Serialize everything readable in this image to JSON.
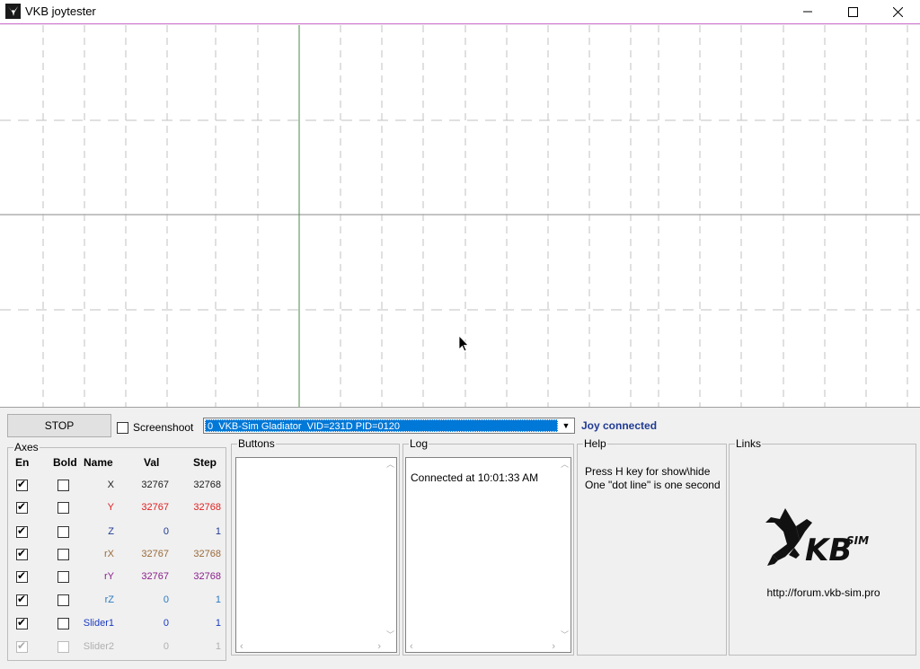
{
  "window": {
    "title": "VKB joytester",
    "minimize_label": "—",
    "maximize_label": "☐",
    "close_label": "✕"
  },
  "controls": {
    "stop_label": "STOP",
    "screenshot_label": "Screenshoot",
    "screenshot_checked": false,
    "device_selected": "0  VKB-Sim Gladiator  VID=231D PID=0120",
    "status": "Joy connected"
  },
  "axes": {
    "title": "Axes",
    "headers": {
      "en": "En",
      "bold": "Bold",
      "name": "Name",
      "val": "Val",
      "step": "Step"
    },
    "rows": [
      {
        "name": "X",
        "val": "32767",
        "step": "32768",
        "color": "#1a1a1a",
        "en": true,
        "bold": false,
        "disabled": false
      },
      {
        "name": "Y",
        "val": "32767",
        "step": "32768",
        "color": "#e02020",
        "en": true,
        "bold": false,
        "disabled": false
      },
      {
        "name": "Z",
        "val": "0",
        "step": "1",
        "color": "#1f3a93",
        "en": true,
        "bold": false,
        "disabled": false
      },
      {
        "name": "rX",
        "val": "32767",
        "step": "32768",
        "color": "#9a6a3a",
        "en": true,
        "bold": false,
        "disabled": false
      },
      {
        "name": "rY",
        "val": "32767",
        "step": "32768",
        "color": "#8a1f8a",
        "en": true,
        "bold": false,
        "disabled": false
      },
      {
        "name": "rZ",
        "val": "0",
        "step": "1",
        "color": "#2a7ac0",
        "en": true,
        "bold": false,
        "disabled": false
      },
      {
        "name": "Slider1",
        "val": "0",
        "step": "1",
        "color": "#1a3ac0",
        "en": true,
        "bold": false,
        "disabled": false
      },
      {
        "name": "Slider2",
        "val": "0",
        "step": "1",
        "color": "#b0b0b0",
        "en": true,
        "bold": false,
        "disabled": true
      }
    ]
  },
  "buttons_panel": {
    "title": "Buttons"
  },
  "log_panel": {
    "title": "Log",
    "entries": [
      "Connected at 10:01:33 AM"
    ]
  },
  "help_panel": {
    "title": "Help",
    "line1": "Press H key for show\\hide",
    "line2": "One \"dot line\" is one second"
  },
  "links_panel": {
    "title": "Links",
    "logo_text": "KB",
    "logo_sup": "SIM",
    "url": "http://forum.vkb-sim.pro"
  },
  "colors": {
    "graph_border": "#d070d0",
    "x_axis_line": "#4a8a4a",
    "status": "#1f3a93",
    "selection": "#0078d7"
  }
}
